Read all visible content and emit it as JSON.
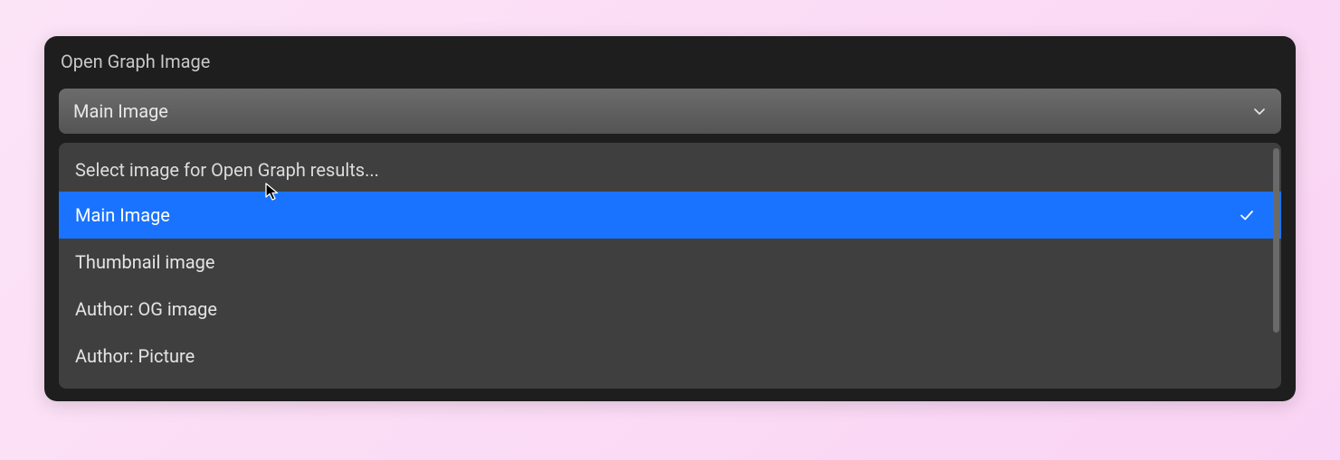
{
  "panel": {
    "title": "Open Graph Image"
  },
  "select": {
    "value": "Main Image"
  },
  "dropdown": {
    "placeholder": "Select image for Open Graph results...",
    "options": [
      {
        "label": "Main Image",
        "selected": true
      },
      {
        "label": "Thumbnail image",
        "selected": false
      },
      {
        "label": "Author: OG image",
        "selected": false
      },
      {
        "label": "Author: Picture",
        "selected": false
      }
    ]
  }
}
